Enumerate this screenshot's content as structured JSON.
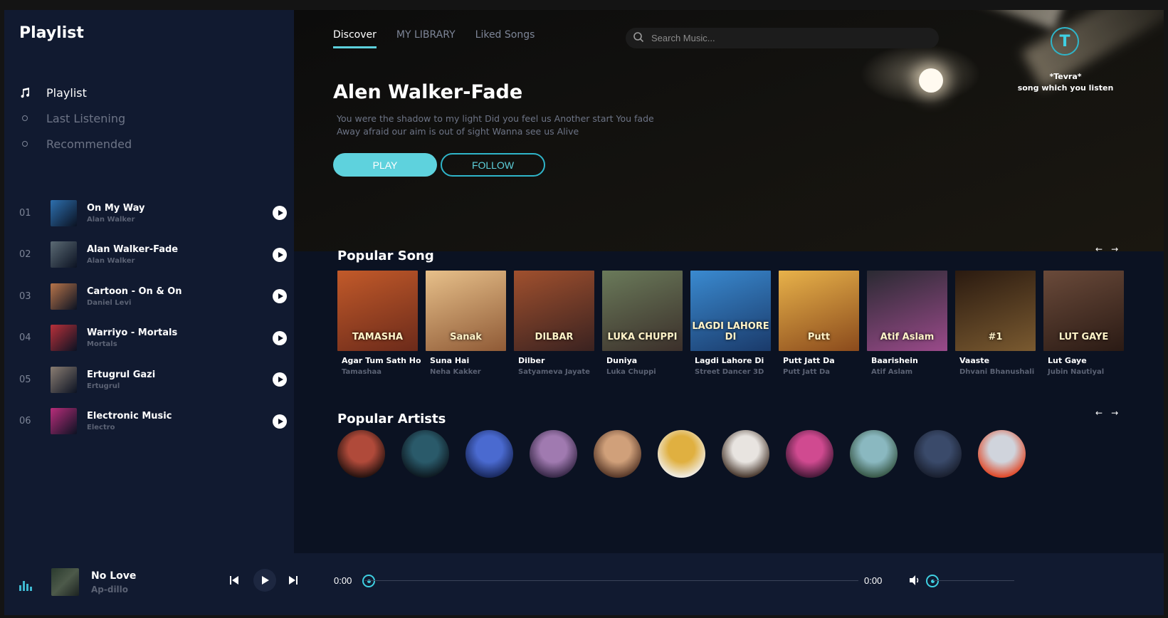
{
  "sidebar": {
    "title": "Playlist",
    "nav": [
      {
        "label": "Playlist",
        "icon": "music-note-icon",
        "active": true
      },
      {
        "label": "Last Listening",
        "icon": "circle-icon",
        "active": false
      },
      {
        "label": "Recommended",
        "icon": "circle-icon",
        "active": false
      }
    ],
    "tracks": [
      {
        "num": "01",
        "title": "On My Way",
        "artist": "Alan Walker",
        "color": "#2d6fae"
      },
      {
        "num": "02",
        "title": "Alan Walker-Fade",
        "artist": "Alan Walker",
        "color": "#5b6a74"
      },
      {
        "num": "03",
        "title": "Cartoon - On & On",
        "artist": "Daniel Levi",
        "color": "#b7744a"
      },
      {
        "num": "04",
        "title": "Warriyo - Mortals",
        "artist": "Mortals",
        "color": "#b8303a"
      },
      {
        "num": "05",
        "title": "Ertugrul Gazi",
        "artist": "Ertugrul",
        "color": "#8a7d72"
      },
      {
        "num": "06",
        "title": "Electronic Music",
        "artist": "Electro",
        "color": "#b82d7a"
      }
    ]
  },
  "header": {
    "tabs": [
      "Discover",
      "MY LIBRARY",
      "Liked Songs"
    ],
    "search_placeholder": "Search Music...",
    "logo_letter": "T",
    "tagline_1": "*Tevra*",
    "tagline_2": "song which you listen"
  },
  "hero": {
    "title": "Alen Walker-Fade",
    "lyrics": "You were the shadow to my light Did you feel us Another start You fade Away afraid our aim is out of sight Wanna see us Alive",
    "play_label": "PLAY",
    "follow_label": "FOLLOW"
  },
  "popular_songs": {
    "title": "Popular Song",
    "items": [
      {
        "title": "Agar Tum Sath Ho",
        "sub": "Tamashaa",
        "cover_text": "TAMASHA",
        "c1": "#c25a2a",
        "c2": "#6b2a1a"
      },
      {
        "title": "Suna Hai",
        "sub": "Neha Kakker",
        "cover_text": "Sanak",
        "c1": "#e7c08a",
        "c2": "#8f5a36"
      },
      {
        "title": "Dilber",
        "sub": "Satyameva Jayate",
        "cover_text": "DILBAR",
        "c1": "#a0502e",
        "c2": "#3a2220"
      },
      {
        "title": "Duniya",
        "sub": "Luka Chuppi",
        "cover_text": "LUKA CHUPPI",
        "c1": "#6a7a5a",
        "c2": "#3b2f2a"
      },
      {
        "title": "Lagdi Lahore Di",
        "sub": "Street Dancer 3D",
        "cover_text": "LAGDI LAHORE DI",
        "c1": "#3a8ad0",
        "c2": "#1a3a6a"
      },
      {
        "title": "Putt Jatt Da",
        "sub": "Putt Jatt Da",
        "cover_text": "Putt",
        "c1": "#e8b24a",
        "c2": "#8a4a1c"
      },
      {
        "title": "Baarishein",
        "sub": "Atif Aslam",
        "cover_text": "Atif Aslam",
        "c1": "#2a2a32",
        "c2": "#9a4a8a"
      },
      {
        "title": "Vaaste",
        "sub": "Dhvani Bhanushali",
        "cover_text": "#1",
        "c1": "#2a1a10",
        "c2": "#7a5a30"
      },
      {
        "title": "Lut Gaye",
        "sub": "Jubin Nautiyal",
        "cover_text": "LUT GAYE",
        "c1": "#6a4a3a",
        "c2": "#2a1a14"
      }
    ]
  },
  "popular_artists": {
    "title": "Popular Artists",
    "items": [
      {
        "name": "artist-1",
        "c1": "#b04a3a",
        "c2": "#2a1410"
      },
      {
        "name": "artist-2",
        "c1": "#2a5a6a",
        "c2": "#0e1a22"
      },
      {
        "name": "artist-3",
        "c1": "#4a6ad0",
        "c2": "#1a2a60"
      },
      {
        "name": "artist-4",
        "c1": "#a07ab0",
        "c2": "#3a2a4a"
      },
      {
        "name": "artist-5",
        "c1": "#d0a07a",
        "c2": "#5a3a2a"
      },
      {
        "name": "artist-6",
        "c1": "#e0b040",
        "c2": "#f0ece4"
      },
      {
        "name": "artist-7",
        "c1": "#e8e4e0",
        "c2": "#4a3a30"
      },
      {
        "name": "artist-8",
        "c1": "#d04a90",
        "c2": "#4a1a3a"
      },
      {
        "name": "artist-9",
        "c1": "#8ab8c0",
        "c2": "#3a5a4a"
      },
      {
        "name": "artist-10",
        "c1": "#3a4a6a",
        "c2": "#1a2030"
      },
      {
        "name": "artist-11",
        "c1": "#d0d4dc",
        "c2": "#e04a2a"
      }
    ]
  },
  "player": {
    "title": "No Love",
    "artist": "Ap-dillo",
    "time_current": "0:00",
    "time_total": "0:00",
    "progress": 0,
    "volume": 0
  },
  "colors": {
    "accent": "#5ed2dd",
    "bg": "#0b1222",
    "sidebar": "#111a30"
  }
}
